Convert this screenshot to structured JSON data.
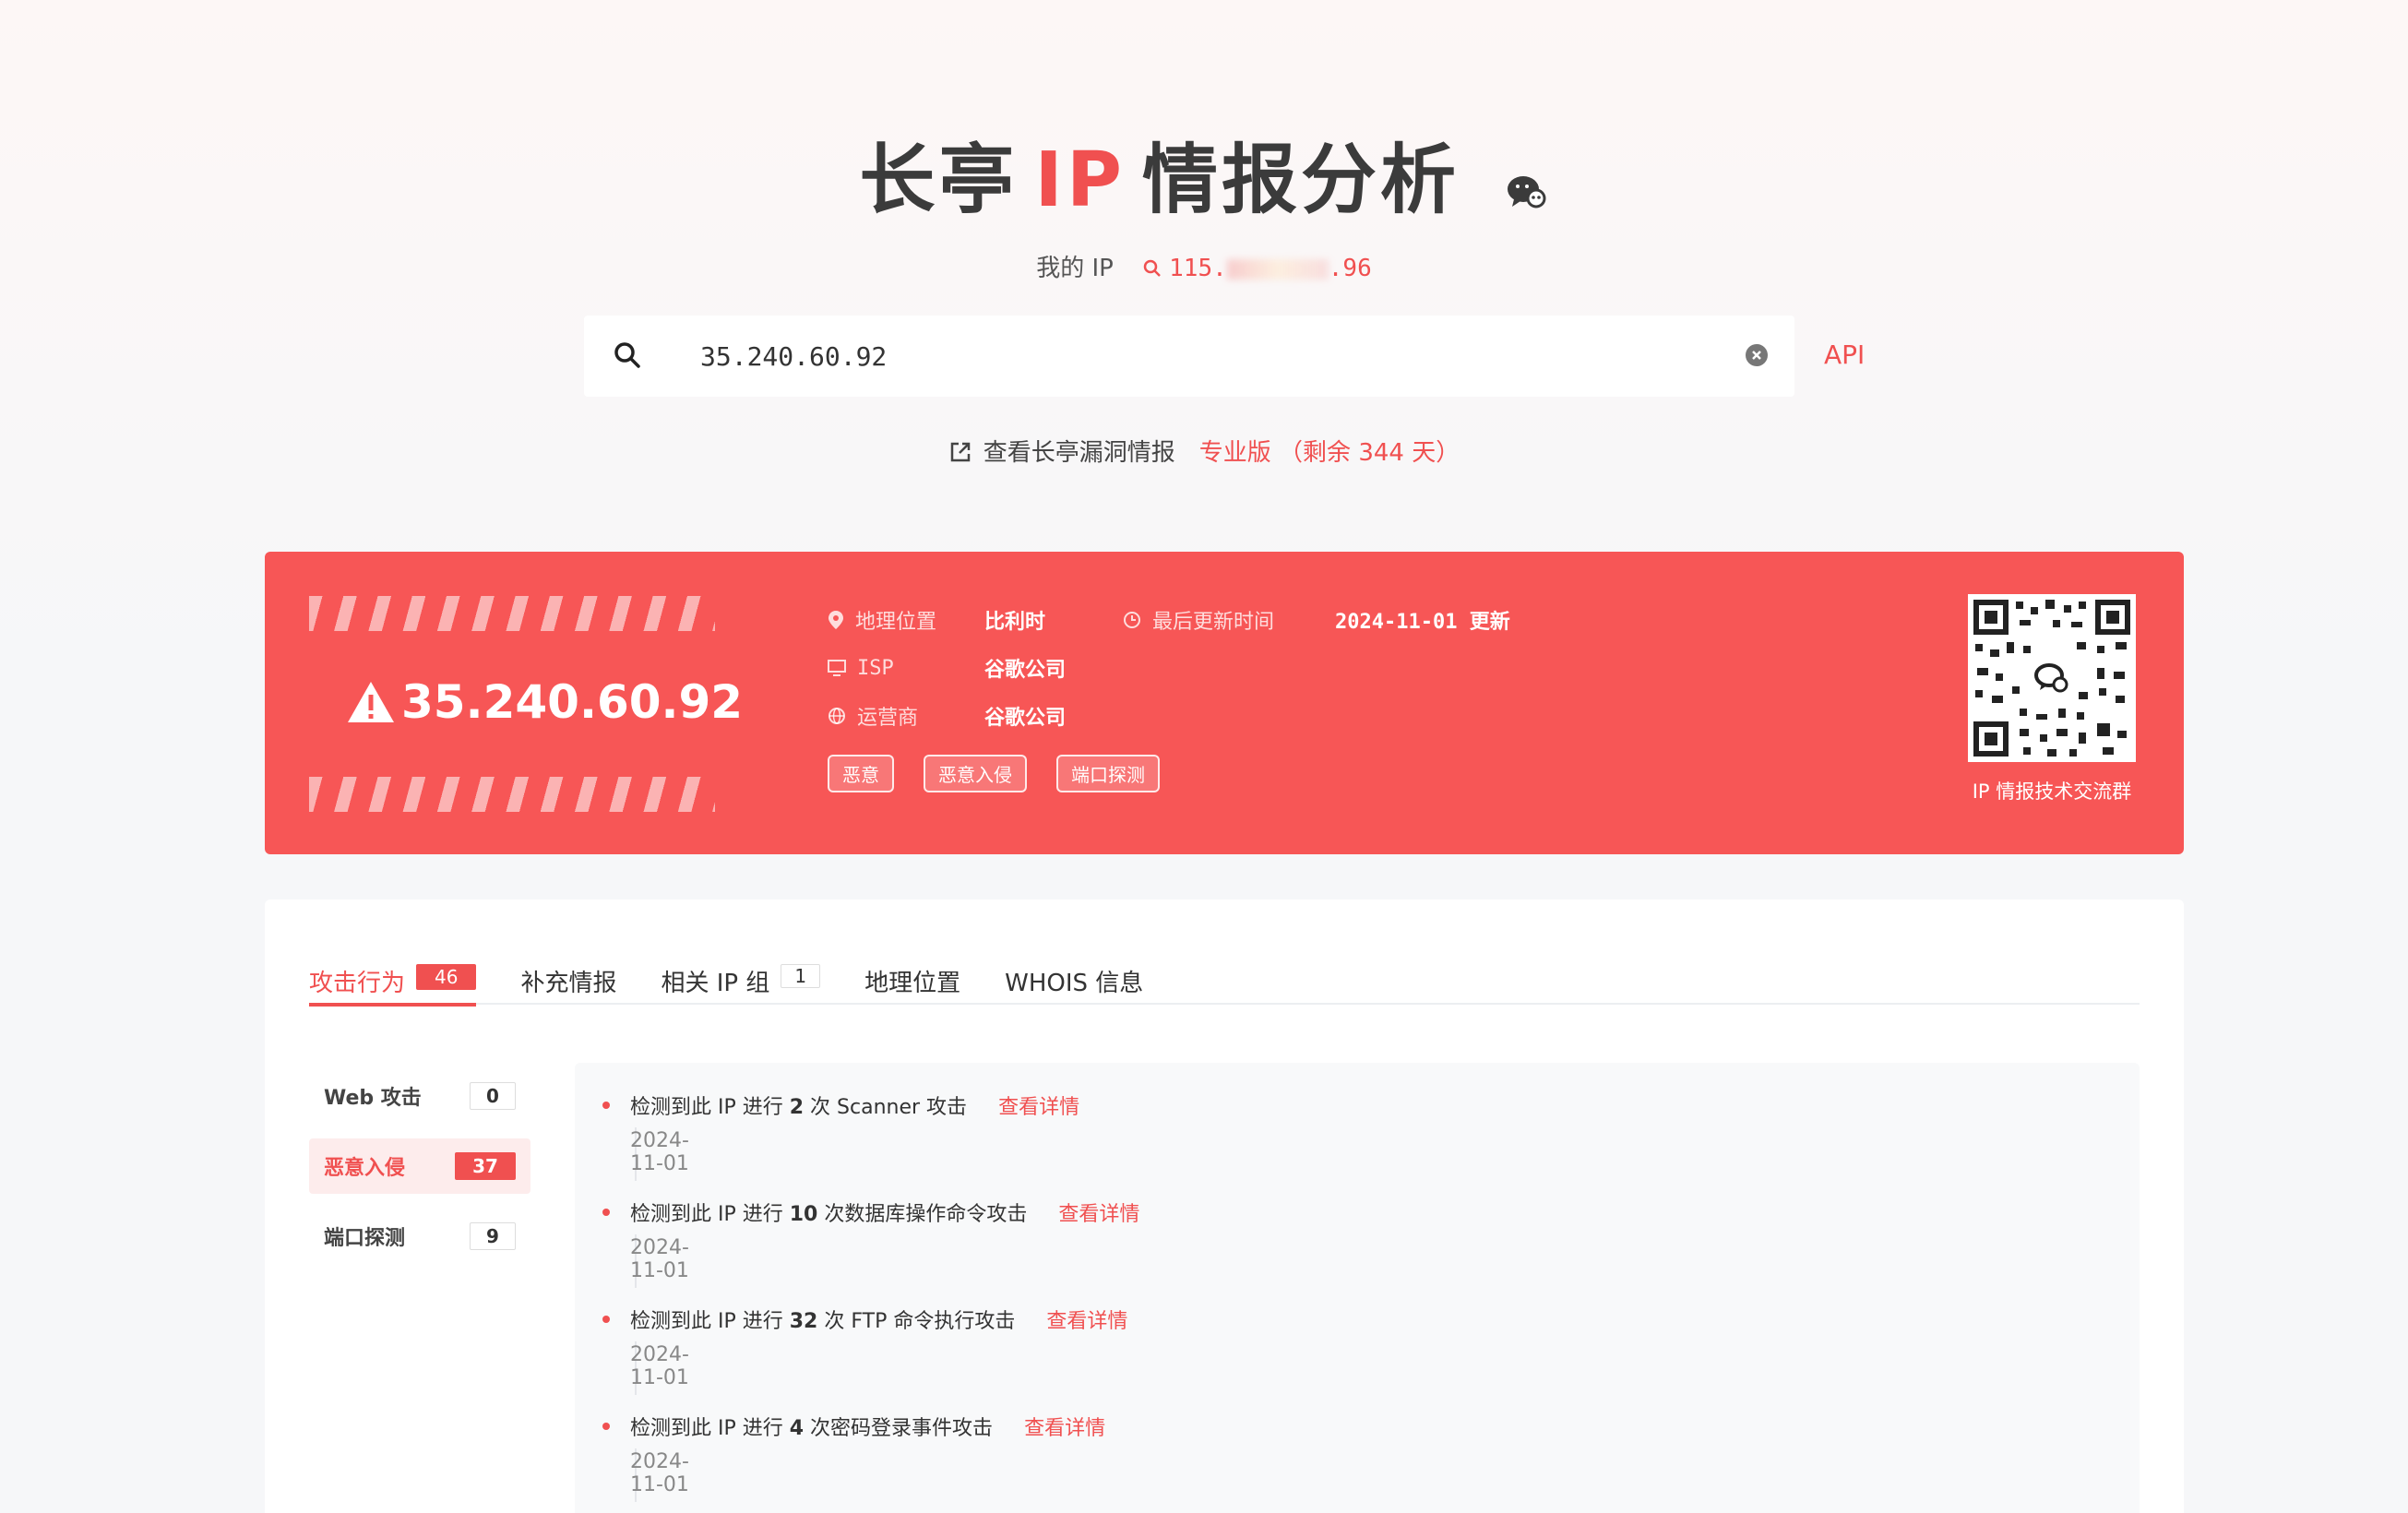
{
  "header": {
    "title_pre": "长亭",
    "title_ip": "IP",
    "title_post": "情报分析",
    "my_ip_label": "我的 IP",
    "my_ip_prefix": "115.",
    "my_ip_suffix": ".96"
  },
  "search": {
    "value": "35.240.60.92",
    "placeholder": "",
    "api_label": "API"
  },
  "vuln": {
    "text": "查看长亭漏洞情报",
    "pro": "专业版 （剩余 344 天）"
  },
  "card": {
    "ip": "35.240.60.92",
    "geo_label": "地理位置",
    "geo_value": "比利时",
    "update_label": "最后更新时间",
    "update_value": "2024-11-01 更新",
    "isp_label": "ISP",
    "isp_value": "谷歌公司",
    "carrier_label": "运营商",
    "carrier_value": "谷歌公司",
    "tags": [
      "恶意",
      "恶意入侵",
      "端口探测"
    ],
    "qr_caption": "IP 情报技术交流群"
  },
  "tabs": [
    {
      "label": "攻击行为",
      "count": "46"
    },
    {
      "label": "补充情报"
    },
    {
      "label": "相关 IP 组",
      "count": "1"
    },
    {
      "label": "地理位置"
    },
    {
      "label": "WHOIS 信息"
    }
  ],
  "side": [
    {
      "label": "Web 攻击",
      "count": "0"
    },
    {
      "label": "恶意入侵",
      "count": "37"
    },
    {
      "label": "端口探测",
      "count": "9"
    }
  ],
  "events": [
    {
      "pre": "检测到此 IP 进行 ",
      "num": "2",
      "post": " 次 Scanner 攻击",
      "detail": "查看详情",
      "date": "2024-11-01"
    },
    {
      "pre": "检测到此 IP 进行 ",
      "num": "10",
      "post": " 次数据库操作命令攻击",
      "detail": "查看详情",
      "date": "2024-11-01"
    },
    {
      "pre": "检测到此 IP 进行 ",
      "num": "32",
      "post": " 次 FTP 命令执行攻击",
      "detail": "查看详情",
      "date": "2024-11-01"
    },
    {
      "pre": "检测到此 IP 进行 ",
      "num": "4",
      "post": " 次密码登录事件攻击",
      "detail": "查看详情",
      "date": "2024-11-01"
    }
  ],
  "colors": {
    "accent": "#f05050",
    "card": "#f75656"
  }
}
